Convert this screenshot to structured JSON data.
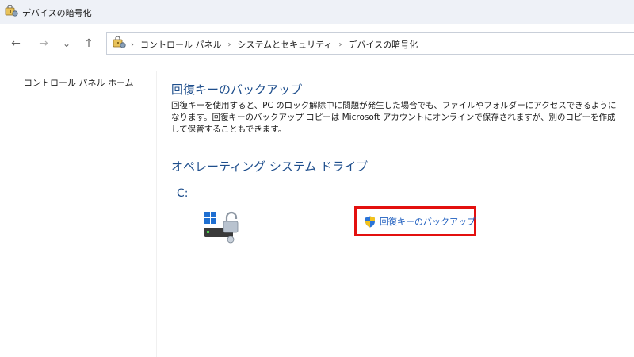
{
  "window": {
    "title": "デバイスの暗号化"
  },
  "nav": {
    "back_icon": "←",
    "forward_icon": "→",
    "recent_icon": "⌄",
    "up_icon": "↑"
  },
  "address": {
    "crumbs": [
      "コントロール パネル",
      "システムとセキュリティ",
      "デバイスの暗号化"
    ],
    "separator": "›",
    "lead_separator": "›"
  },
  "sidebar": {
    "home_link": "コントロール パネル ホーム"
  },
  "main": {
    "section1_title": "回復キーのバックアップ",
    "section1_desc": "回復キーを使用すると、PC のロック解除中に問題が発生した場合でも、ファイルやフォルダーにアクセスできるようになります。回復キーのバックアップ コピーは Microsoft アカウントにオンラインで保存されますが、別のコピーを作成して保管することもできます。",
    "section2_title": "オペレーティング システム ドライブ",
    "drive_label": "C:",
    "backup_link": "回復キーのバックアップ"
  },
  "colors": {
    "heading": "#1e4e8c",
    "link": "#1e5ebf",
    "highlight_box": "#e3100f"
  }
}
